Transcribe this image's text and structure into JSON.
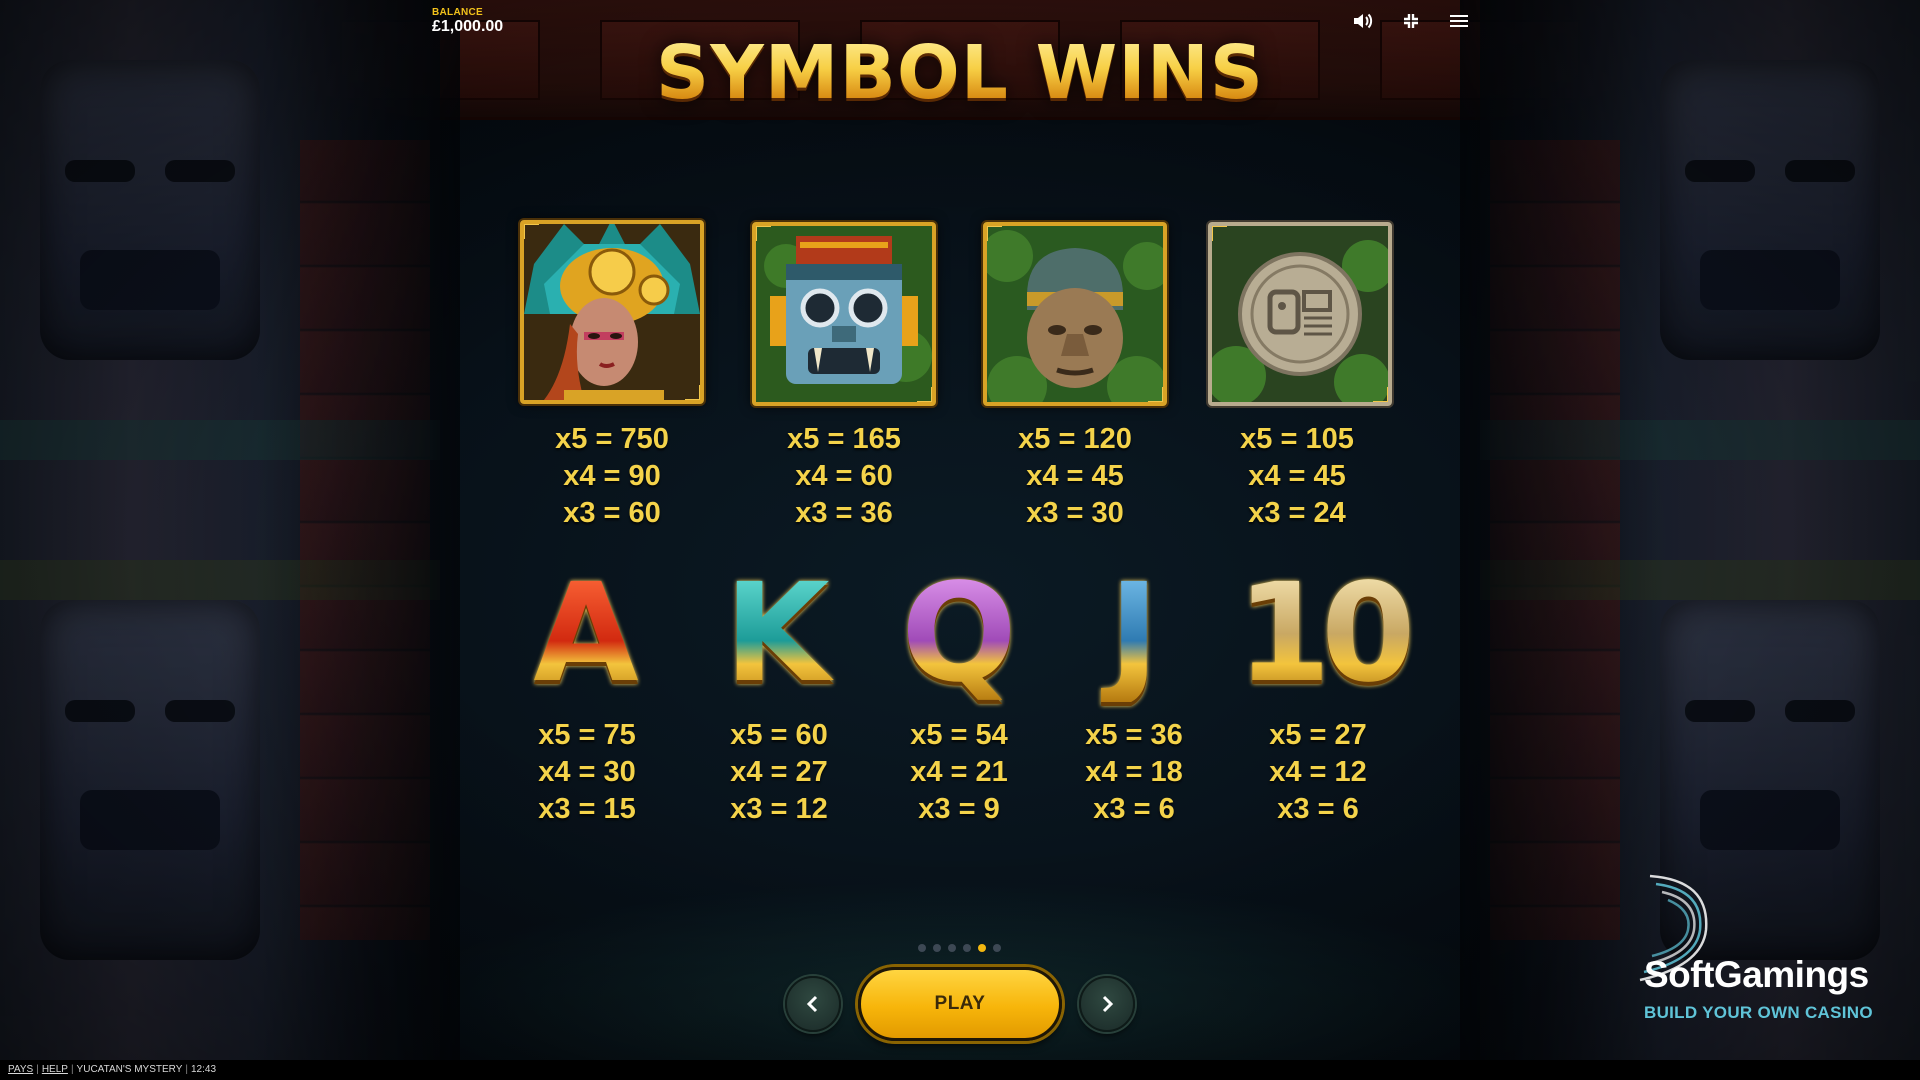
{
  "balance": {
    "label": "BALANCE",
    "value": "£1,000.00"
  },
  "top_icons": [
    "sound-icon",
    "exit-fullscreen-icon",
    "menu-icon"
  ],
  "title": "SYMBOL WINS",
  "premium_symbols": [
    {
      "name": "warrior-woman",
      "pays": [
        "x5 = 750",
        "x4 = 90",
        "x3 = 60"
      ]
    },
    {
      "name": "tiki-mask",
      "pays": [
        "x5 = 165",
        "x4 = 60",
        "x3 = 36"
      ]
    },
    {
      "name": "olmec-head",
      "pays": [
        "x5 = 120",
        "x4 = 45",
        "x3 = 30"
      ]
    },
    {
      "name": "stone-calendar",
      "pays": [
        "x5 = 105",
        "x4 = 45",
        "x3 = 24"
      ]
    }
  ],
  "card_symbols": [
    {
      "glyph": "A",
      "pays": [
        "x5 = 75",
        "x4 = 30",
        "x3 = 15"
      ]
    },
    {
      "glyph": "K",
      "pays": [
        "x5 = 60",
        "x4 = 27",
        "x3 = 12"
      ]
    },
    {
      "glyph": "Q",
      "pays": [
        "x5 = 54",
        "x4 = 21",
        "x3 = 9"
      ]
    },
    {
      "glyph": "J",
      "pays": [
        "x5 = 36",
        "x4 = 18",
        "x3 = 6"
      ]
    },
    {
      "glyph": "10",
      "pays": [
        "x5 = 27",
        "x4 = 12",
        "x3 = 6"
      ]
    }
  ],
  "pagination": {
    "total": 6,
    "active_index": 4
  },
  "play_label": "PLAY",
  "footer": {
    "pays": "PAYS",
    "help": "HELP",
    "game": "YUCATAN'S MYSTERY",
    "time": "12:43"
  },
  "brand": {
    "name": "SoftGamings",
    "tagline": "BUILD YOUR OWN CASINO"
  },
  "colors": {
    "gold": "#f4d34a",
    "title_gold": "#f6c443",
    "play_yellow": "#f7b50a",
    "active_dot": "#f3b710",
    "brand_teal": "#5fc4d8"
  }
}
